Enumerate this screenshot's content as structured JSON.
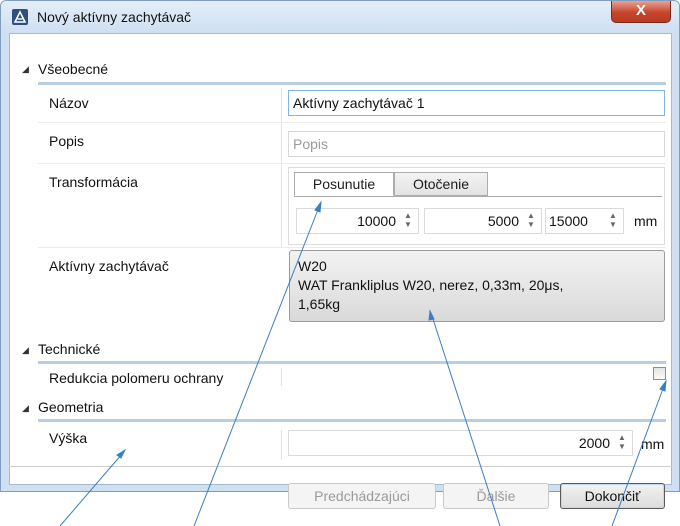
{
  "window": {
    "title": "Nový aktívny zachytávač",
    "close_glyph": "X"
  },
  "sections": {
    "general": {
      "label": "Všeobecné",
      "name": {
        "label": "Názov",
        "value": "Aktívny zachytávač 1"
      },
      "description": {
        "label": "Popis",
        "placeholder": "Popis"
      },
      "transform": {
        "label": "Transformácia",
        "tabs": [
          "Posunutie",
          "Otočenie"
        ],
        "x": "10000",
        "y": "5000",
        "z": "15000",
        "unit": "mm"
      },
      "device": {
        "label": "Aktívny zachytávač",
        "line1": "W20",
        "line2": "WAT Frankliplus W20, nerez, 0,33m, 20μs,",
        "line3": "1,65kg"
      }
    },
    "technical": {
      "label": "Technické",
      "radius_reduction": {
        "label": "Redukcia polomeru ochrany",
        "checked": false
      }
    },
    "geometry": {
      "label": "Geometria",
      "height": {
        "label": "Výška",
        "value": "2000",
        "unit": "mm"
      }
    }
  },
  "footer": {
    "previous": "Predchádzajúci",
    "next": "Ďalšie",
    "finish": "Dokončiť"
  },
  "icons": {
    "collapse": "◢",
    "spin_up": "▲",
    "spin_down": "▼"
  },
  "colors": {
    "accent": "#b9cde3",
    "close": "#c7452c",
    "annotation": "#3a7fc2"
  }
}
